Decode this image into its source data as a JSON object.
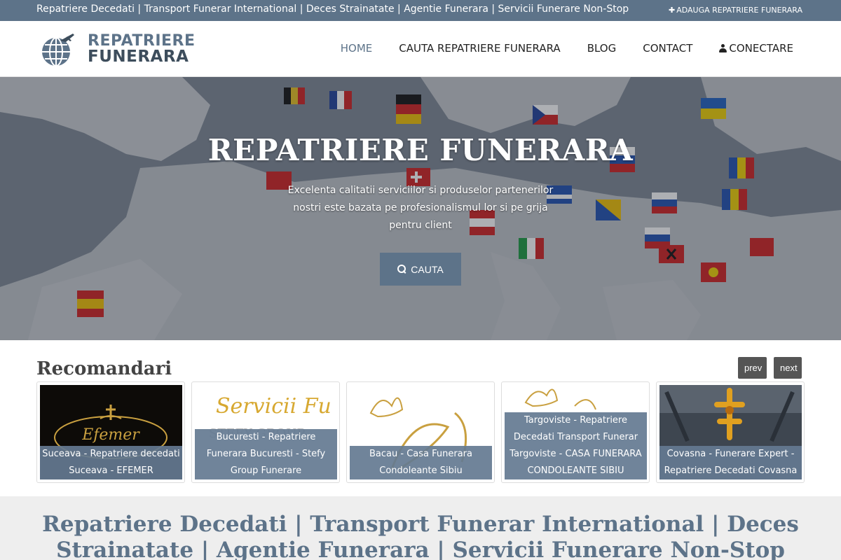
{
  "topbar": {
    "tagline": "Repatriere Decedati | Transport Funerar International | Deces Strainatate | Agentie Funerara | Servicii Funerare Non-Stop",
    "add_link": "ADAUGA REPATRIERE FUNERARA"
  },
  "logo": {
    "line1": "REPATRIERE",
    "line2": "FUNERARA"
  },
  "nav": {
    "items": [
      {
        "label": "HOME",
        "active": true
      },
      {
        "label": "CAUTA REPATRIERE FUNERARA",
        "active": false
      },
      {
        "label": "BLOG",
        "active": false
      },
      {
        "label": "CONTACT",
        "active": false
      },
      {
        "label": "CONECTARE",
        "icon": "user-icon",
        "active": false
      }
    ]
  },
  "hero": {
    "title": "REPATRIERE FUNERARA",
    "subtitle": "Excelenta calitatii serviciilor si produselor partenerilor nostri este bazata pe profesionalismul lor si pe grija pentru client",
    "button_label": "CAUTA",
    "button_icon": "search-icon"
  },
  "recommendations": {
    "title": "Recomandari",
    "prev_label": "prev",
    "next_label": "next",
    "items": [
      {
        "caption": "Suceava - Repatriere decedati Suceava - EFEMER",
        "thumb_lettering": "Efemer"
      },
      {
        "caption": "Bucuresti - Repatriere Funerara Bucuresti - Stefy Group Funerare",
        "thumb_lettering": "Servicii Fu"
      },
      {
        "caption": "Bacau - Casa Funerara Condoleante Sibiu"
      },
      {
        "caption": "Targoviste - Repatriere Decedati Transport Funerar Targoviste - CASA FUNERARA CONDOLEANTE SIBIU"
      },
      {
        "caption": "Covasna - Funerare Expert - Repatriere Decedati Covasna"
      }
    ]
  },
  "banner": {
    "title": "Repatriere Decedati | Transport Funerar International | Deces Strainatate | Agentie Funerara | Servicii Funerare Non-Stop"
  },
  "colors": {
    "primary": "#5d7389",
    "dark": "#3d4d5c",
    "banner_bg": "#eeeeee",
    "pager_bg": "#555555"
  }
}
